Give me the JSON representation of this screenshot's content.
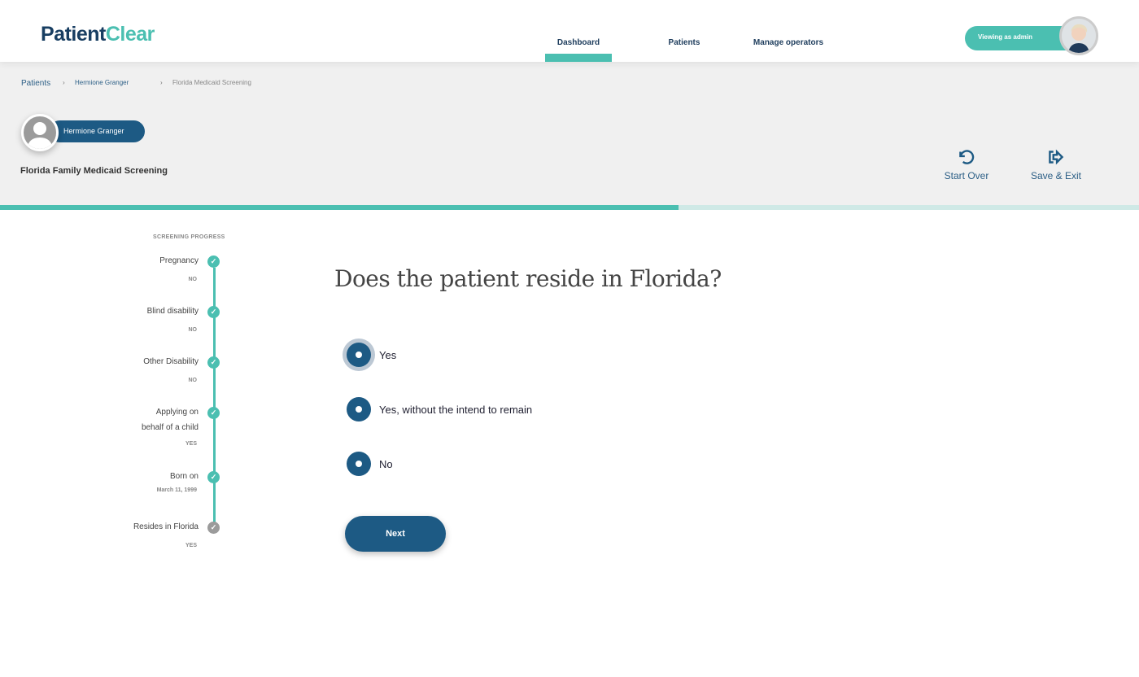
{
  "brand": {
    "part1": "Patient",
    "part2": "Clear"
  },
  "nav": {
    "items": [
      {
        "label": "Dashboard",
        "active": true
      },
      {
        "label": "Patients"
      },
      {
        "label": "Manage operators"
      }
    ]
  },
  "user": {
    "badge": "Viewing as admin"
  },
  "breadcrumb": [
    "Patients",
    "Hermione Granger",
    "Florida Medicaid Screening"
  ],
  "patient": {
    "name": "Hermione Granger"
  },
  "page_title": "Florida Family Medicaid Screening",
  "actions": {
    "start_over": "Start Over",
    "save_exit": "Save & Exit"
  },
  "progress": {
    "percent": 60
  },
  "sidebar": {
    "title": "SCREENING PROGRESS",
    "steps": [
      {
        "label": "Pregnancy",
        "value": "NO",
        "status": "done"
      },
      {
        "label": "Blind disability",
        "value": "NO",
        "status": "done"
      },
      {
        "label": "Other Disability",
        "value": "NO",
        "status": "done"
      },
      {
        "label": "Applying on",
        "label2": "behalf of a child",
        "value": "YES",
        "status": "done"
      },
      {
        "label": "Born on",
        "value": "March 11, 1999",
        "status": "done"
      },
      {
        "label": "Resides in Florida",
        "value": "YES",
        "status": "current"
      }
    ]
  },
  "question": {
    "text": "Does the patient reside in Florida?",
    "options": [
      "Yes",
      "Yes, without  the intend to remain",
      "No"
    ],
    "selected": 0
  },
  "next_label": "Next",
  "colors": {
    "primary": "#1d5a84",
    "accent": "#4bbfb1",
    "brand_dark": "#183e62"
  }
}
